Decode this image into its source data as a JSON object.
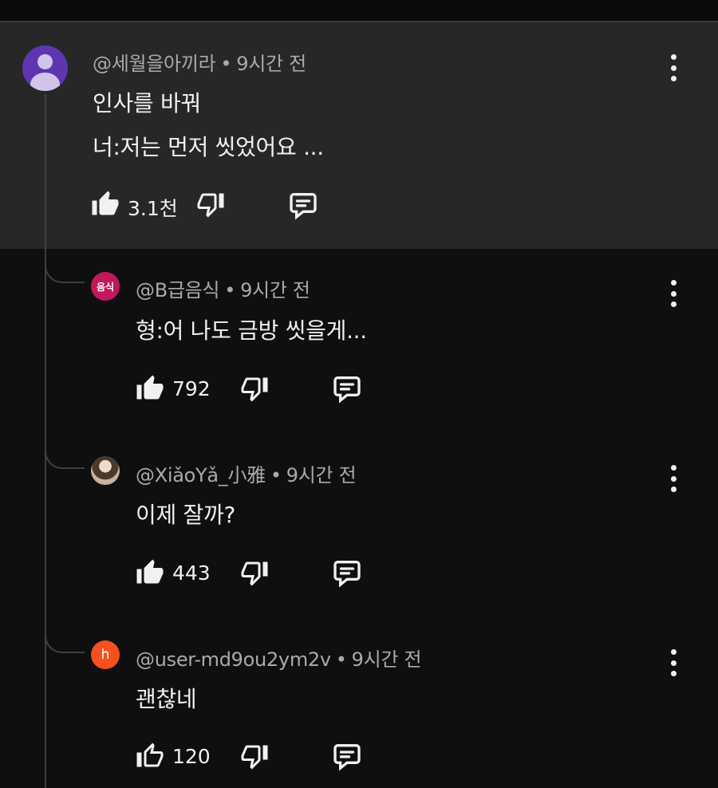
{
  "comments": [
    {
      "author": "@세월을아끼라",
      "time": "9시간 전",
      "lines": [
        "인사를 바꿔",
        "너:저는 먼저 씻었어요 ..."
      ],
      "likes": "3.1천",
      "avatar_color": "#5e35b1"
    },
    {
      "author": "@B급음식",
      "time": "9시간 전",
      "lines": [
        "형:어 나도 금방 씻을게..."
      ],
      "likes": "792",
      "avatar_text": "음식",
      "avatar_color": "#c2185b"
    },
    {
      "author": "@XiǎoYǎ_小雅",
      "time": "9시간 전",
      "lines": [
        "이제 잘까?"
      ],
      "likes": "443"
    },
    {
      "author": "@user-md9ou2ym2v",
      "time": "9시간 전",
      "lines": [
        "괜찮네"
      ],
      "likes": "120",
      "avatar_text": "h",
      "avatar_color": "#f4511e"
    }
  ],
  "separator": "•",
  "icons": {
    "like": "thumbs-up-icon",
    "dislike": "thumbs-down-icon",
    "reply": "comment-reply-icon",
    "menu": "more-vertical-icon"
  }
}
